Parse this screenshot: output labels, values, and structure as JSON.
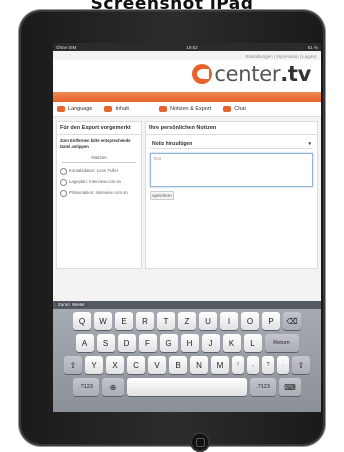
{
  "caption": "Screenshot iPad",
  "status": {
    "carrier": "Ohne SIM",
    "time": "19:52",
    "battery": "61 %"
  },
  "topmeta": "Einstellungen | Impressum | Logout",
  "logo": {
    "name": "center",
    "tld": ".tv"
  },
  "tabs": [
    {
      "label": "Language"
    },
    {
      "label": "Inhalt"
    },
    {
      "label": "Notizen & Export"
    },
    {
      "label": "Chat"
    }
  ],
  "left": {
    "title": "Für den Export vorgemerkt",
    "hint": "Zum Entfernen bitte entsprechende Datei antippen",
    "notes_header": "Notizen",
    "items": [
      "Kontaktdaten: Leon Fuller",
      "Lageplan: Interview.com.sn",
      "Präsentation: Interview com.sn"
    ]
  },
  "right": {
    "title": "Ihre persönlichen Notizen",
    "select_value": "Notiz hinzufügen",
    "textarea_placeholder": "Text",
    "save_label": "speichern"
  },
  "kb_tools": [
    "Zurück",
    "Weiter"
  ],
  "keyboard": {
    "row1": [
      "Q",
      "W",
      "E",
      "R",
      "T",
      "Z",
      "U",
      "I",
      "O",
      "P",
      "⌫"
    ],
    "row2": [
      "A",
      "S",
      "D",
      "F",
      "G",
      "H",
      "J",
      "K",
      "L",
      "Return"
    ],
    "row3": [
      "⇧",
      "Y",
      "X",
      "C",
      "V",
      "B",
      "N",
      "M",
      "!",
      ",",
      "?",
      ".",
      "⇧"
    ],
    "row4": [
      ".?123",
      "⊕",
      "",
      ".?123",
      "⌨"
    ]
  }
}
